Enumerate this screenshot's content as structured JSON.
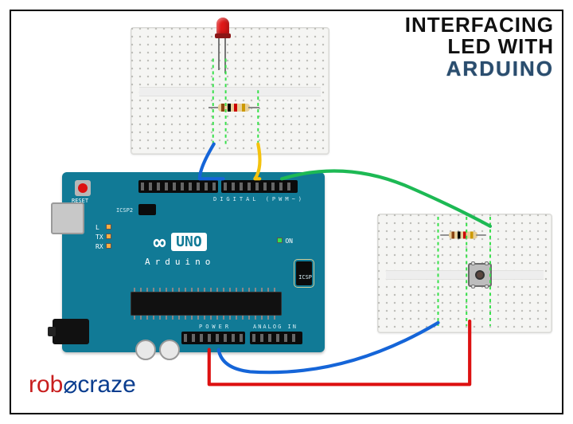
{
  "title": {
    "line1": "INTERFACING",
    "line2": "LED WITH",
    "line3": "ARDUINO"
  },
  "logo": {
    "part1": "rob",
    "part2": "craze"
  },
  "arduino": {
    "reset_label": "RESET",
    "digital_label": "DIGITAL (PWM~)",
    "power_label": "POWER",
    "analog_label": "ANALOG IN",
    "icsp_label": "ICSP",
    "icsp2_label": "ICSP2",
    "brand_glyph": "∞",
    "brand_model": "UNO",
    "brand_text": "Arduino",
    "tx": "TX",
    "rx": "RX",
    "l": "L",
    "on": "ON"
  },
  "components": {
    "led": "red-led",
    "resistor1": "resistor-220-ohm",
    "resistor2": "resistor-10k-ohm",
    "button": "tactile-pushbutton",
    "breadboard": "mini-breadboard"
  },
  "wires": [
    {
      "name": "led-cathode-to-gnd",
      "color": "blue",
      "from": "breadboard-top",
      "to": "arduino-gnd"
    },
    {
      "name": "led-anode-to-pin",
      "color": "yellow",
      "from": "breadboard-top",
      "to": "arduino-digital"
    },
    {
      "name": "button-to-digital",
      "color": "green",
      "from": "arduino-digital",
      "to": "breadboard-right"
    },
    {
      "name": "button-to-gnd",
      "color": "blue",
      "from": "arduino-gnd",
      "to": "breadboard-right"
    },
    {
      "name": "button-to-5v",
      "color": "red",
      "from": "arduino-5v",
      "to": "breadboard-right"
    }
  ]
}
